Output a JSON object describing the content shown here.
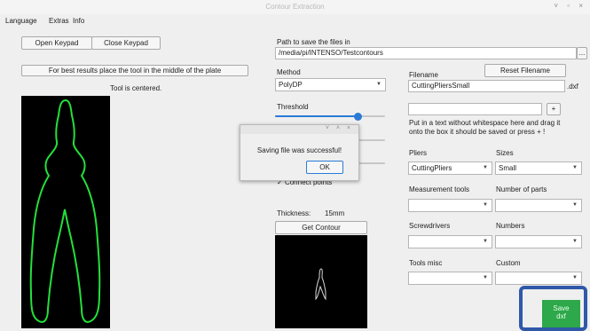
{
  "window": {
    "title": "Contour Extraction",
    "controls": "˅ ▫ ×"
  },
  "menu": [
    "Language",
    "Extras",
    "Info"
  ],
  "left": {
    "open_keypad": "Open Keypad",
    "close_keypad": "Close Keypad",
    "hint_button": "For best results place the tool in the middle of the plate",
    "status": "Tool is centered."
  },
  "path": {
    "label": "Path to save the files in",
    "value": "/media/pi/INTENSO/Testcontours",
    "browse": "..."
  },
  "method": {
    "label": "Method",
    "value": "PolyDP"
  },
  "threshold": {
    "label": "Threshold",
    "level_fraction": 0.75
  },
  "connect_points": {
    "label": "Connect points",
    "checked": true,
    "mark": "✓"
  },
  "thickness": {
    "label": "Thickness:",
    "value": "15mm"
  },
  "get_contour": "Get Contour",
  "filename": {
    "label": "Filename",
    "reset_button": "Reset Filename",
    "value": "CuttingPliersSmall",
    "extension": ".dxf"
  },
  "tag_input": {
    "value": "",
    "add_button": "+",
    "hint_line1": "Put in a text without whitespace here and drag it",
    "hint_line2": "onto the box it should be saved or press + !"
  },
  "categories": {
    "pliers": {
      "label": "Pliers",
      "value": "CuttingPliers"
    },
    "sizes": {
      "label": "Sizes",
      "value": "Small"
    },
    "measurement_tools": {
      "label": "Measurement tools",
      "value": ""
    },
    "number_of_parts": {
      "label": "Number of parts",
      "value": ""
    },
    "screwdrivers": {
      "label": "Screwdrivers",
      "value": ""
    },
    "numbers": {
      "label": "Numbers",
      "value": ""
    },
    "tools_misc": {
      "label": "Tools misc",
      "value": ""
    },
    "custom": {
      "label": "Custom",
      "value": ""
    }
  },
  "save_button": {
    "line1": "Save",
    "line2": "dxf"
  },
  "dialog": {
    "message": "Saving file was successful!",
    "ok": "OK",
    "bar_controls": "˅ ˄ ×"
  },
  "colors": {
    "accent": "#2b7bd6",
    "contour": "#23e03a",
    "save_green": "#2da84a",
    "highlight_frame": "#2f58a8"
  }
}
